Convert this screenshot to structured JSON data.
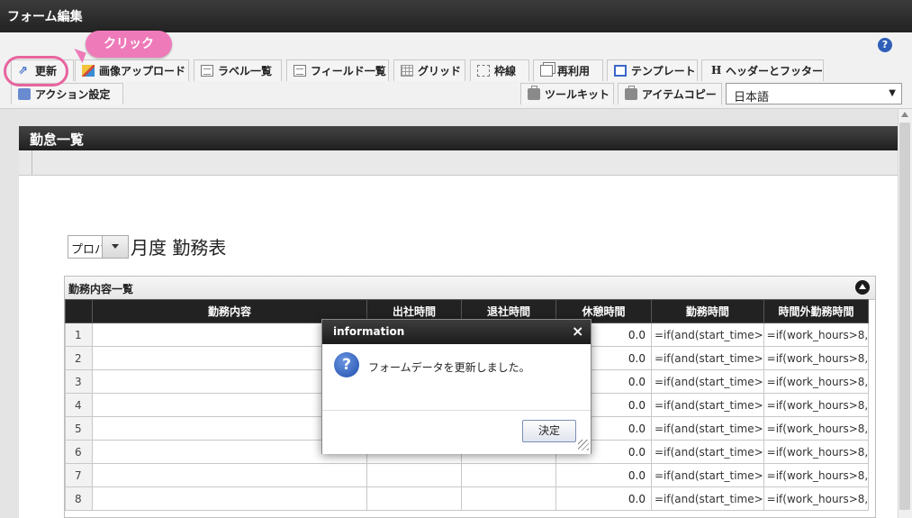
{
  "window": {
    "title": "フォーム編集"
  },
  "toolbar": {
    "row1": [
      "更新",
      "画像アップロード",
      "ラベル一覧",
      "フィールド一覧",
      "グリッド",
      "枠線",
      "再利用",
      "テンプレート",
      "ヘッダーとフッター"
    ],
    "row2_left": "アクション設定",
    "row2_right": [
      "ツールキット",
      "アイテムコピー"
    ],
    "header_icon_letter": "H",
    "help": "?",
    "language": "日本語"
  },
  "callout": {
    "text": "クリック"
  },
  "form": {
    "title": "勤怠一覧",
    "select_value": "プロパ",
    "heading": "月度 勤務表",
    "panel_title": "勤務内容一覧",
    "columns": [
      "勤務内容",
      "出社時間",
      "退社時間",
      "休憩時間",
      "勤務時間",
      "時間外勤務時間"
    ],
    "rows": [
      {
        "no": "1",
        "break": "0.0",
        "hours": "=if(and(start_time>",
        "overtime": "=if(work_hours>8,"
      },
      {
        "no": "2",
        "break": "0.0",
        "hours": "=if(and(start_time>",
        "overtime": "=if(work_hours>8,"
      },
      {
        "no": "3",
        "break": "0.0",
        "hours": "=if(and(start_time>",
        "overtime": "=if(work_hours>8,"
      },
      {
        "no": "4",
        "break": "0.0",
        "hours": "=if(and(start_time>",
        "overtime": "=if(work_hours>8,"
      },
      {
        "no": "5",
        "break": "0.0",
        "hours": "=if(and(start_time>",
        "overtime": "=if(work_hours>8,"
      },
      {
        "no": "6",
        "break": "0.0",
        "hours": "=if(and(start_time>",
        "overtime": "=if(work_hours>8,"
      },
      {
        "no": "7",
        "break": "0.0",
        "hours": "=if(and(start_time>",
        "overtime": "=if(work_hours>8,"
      },
      {
        "no": "8",
        "break": "0.0",
        "hours": "=if(and(start_time>",
        "overtime": "=if(work_hours>8,"
      }
    ]
  },
  "dialog": {
    "title": "information",
    "close": "×",
    "message": "フォームデータを更新しました。",
    "ok": "決定"
  },
  "colors": {
    "accent_pink": "#ee7ab9",
    "dark_header": "#222222",
    "icon_blue": "#2f5fb8"
  }
}
